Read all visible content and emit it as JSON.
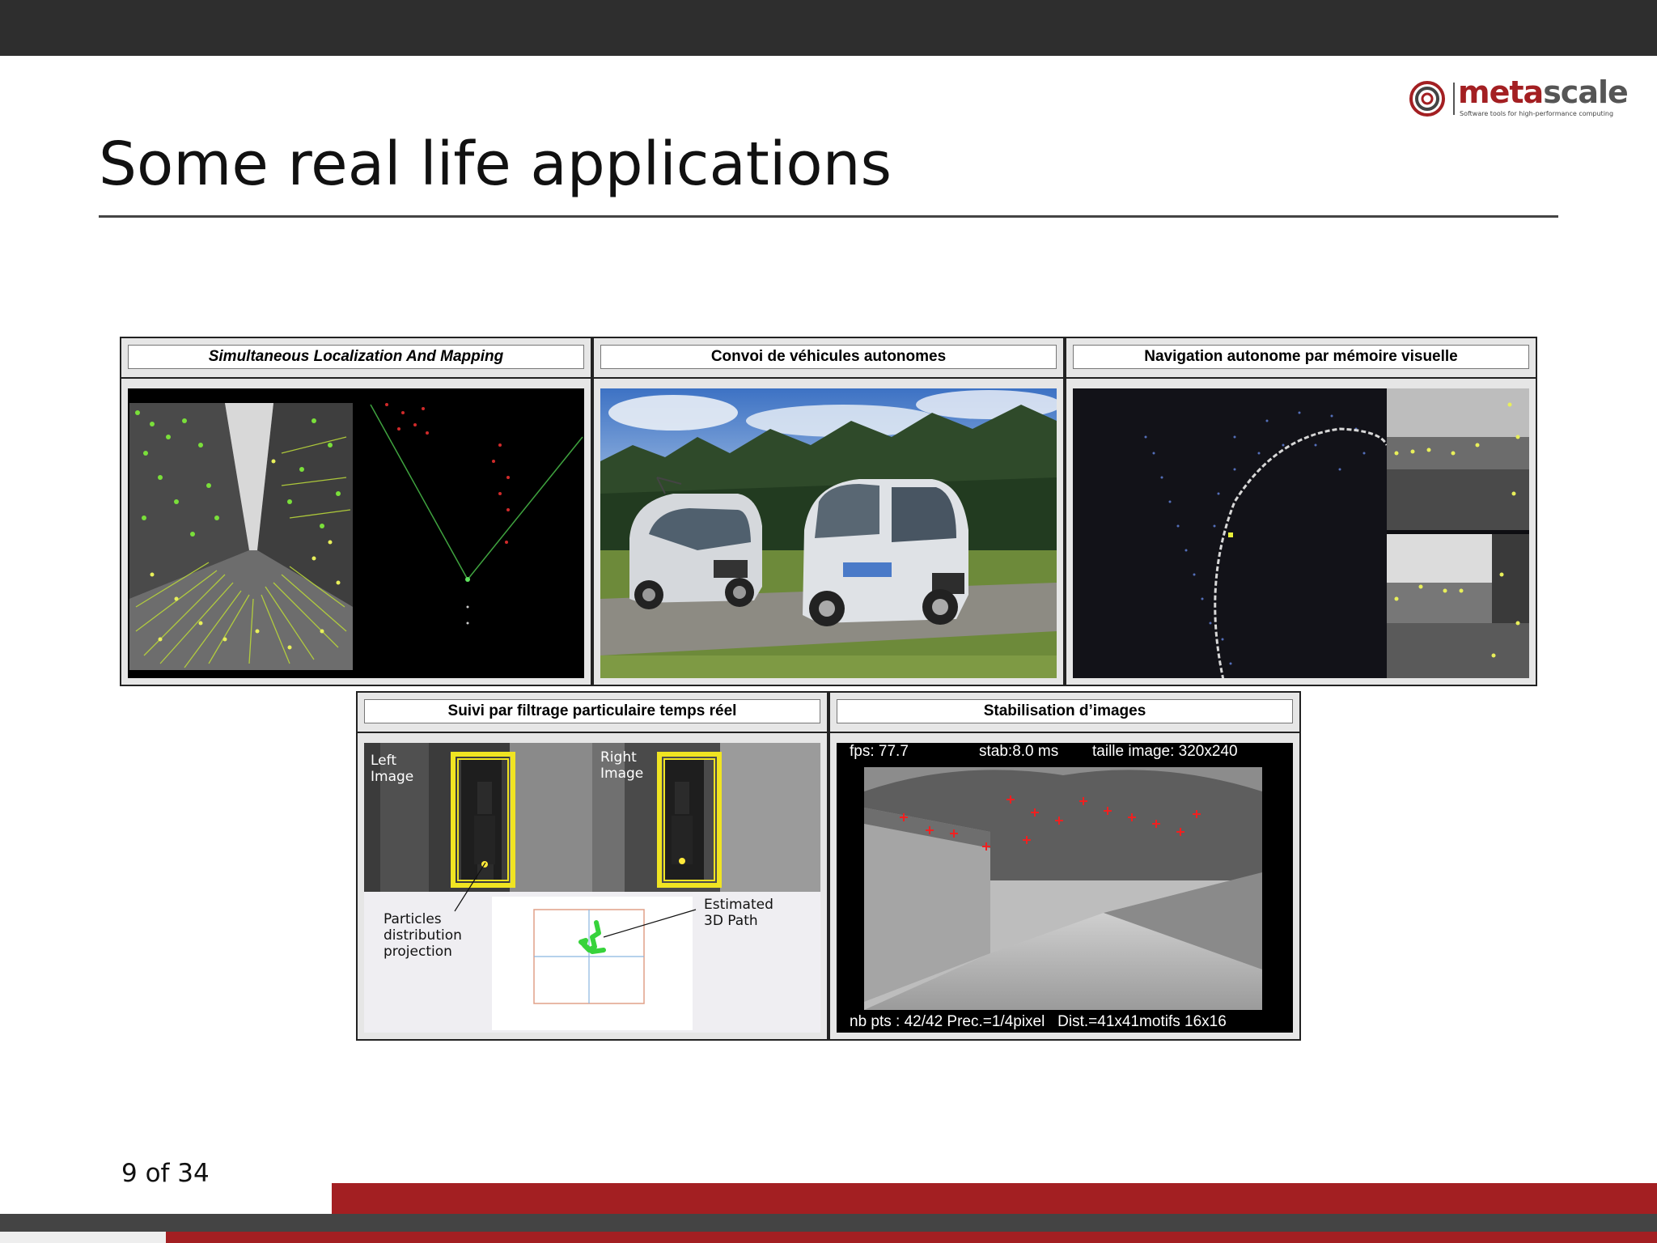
{
  "slide": {
    "title": "Some real life applications",
    "page_number": "9 of 34"
  },
  "logo": {
    "word_part1": "meta",
    "word_part2": "scale",
    "tagline": "Software tools for high-performance computing"
  },
  "panels": {
    "slam": {
      "caption": "Simultaneous Localization And Mapping"
    },
    "convoy": {
      "caption": "Convoi de véhicules autonomes"
    },
    "navigation": {
      "caption": "Navigation autonome par mémoire visuelle"
    },
    "tracking": {
      "caption": "Suivi par filtrage particulaire temps réel",
      "left_label": "Left\nImage",
      "right_label": "Right\nImage",
      "particles_label": "Particles\ndistribution\nprojection",
      "path_label": "Estimated\n3D Path"
    },
    "stabilisation": {
      "caption": "Stabilisation d’images",
      "fps": "fps: 77.7",
      "stab": "stab:8.0 ms",
      "size": "taille image: 320x240",
      "footer": "nb pts : 42/42 Prec.=1/4pixel   Dist.=41x41motifs 16x16"
    }
  },
  "colors": {
    "brand_red": "#a31f22",
    "dark_bar": "#2e2e2e"
  }
}
